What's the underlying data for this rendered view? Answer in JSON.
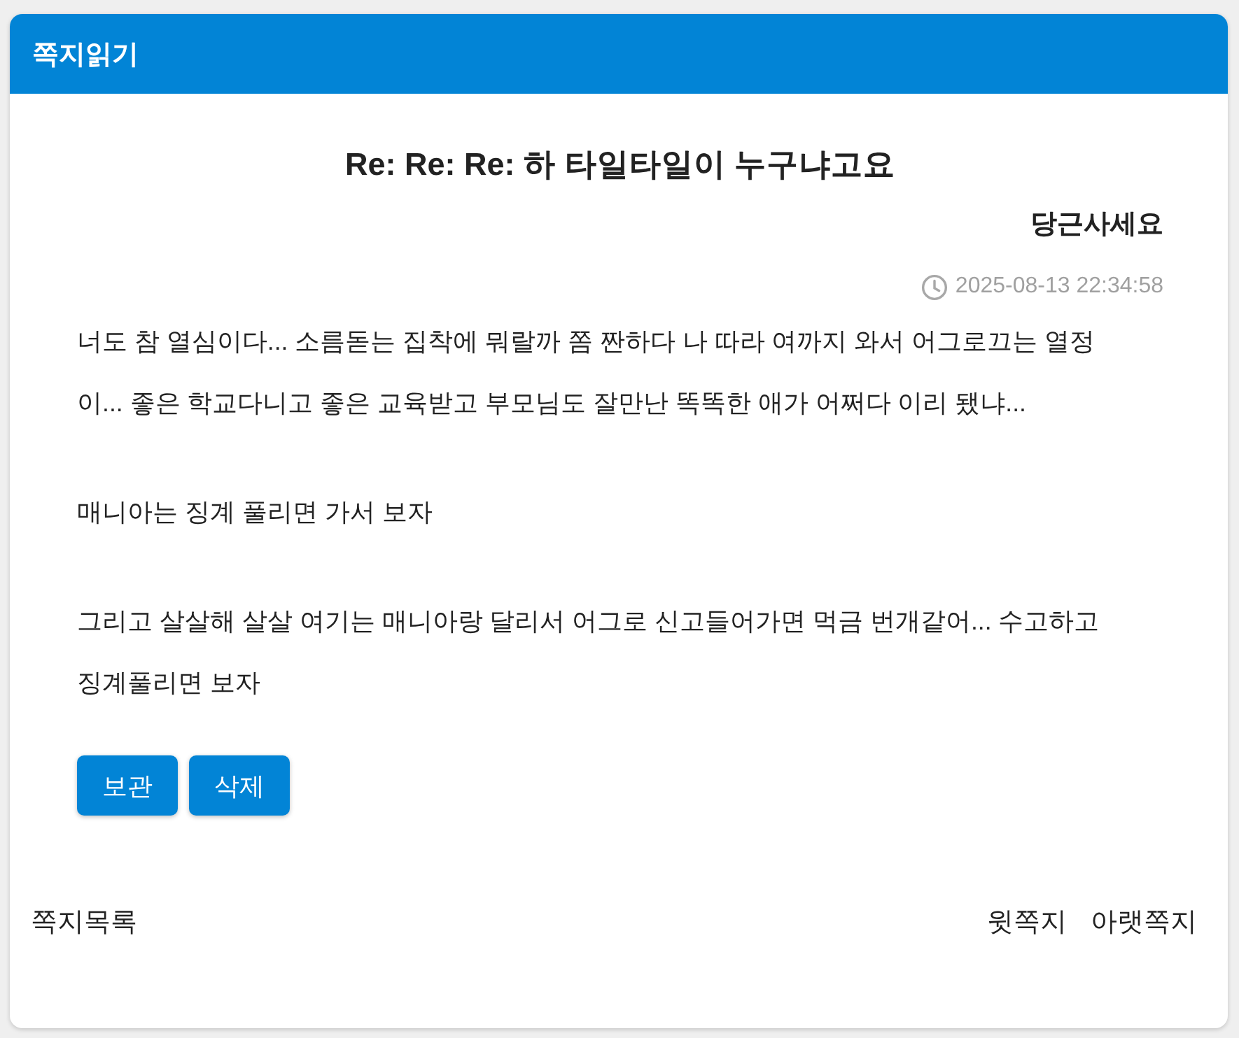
{
  "window": {
    "title": "쪽지읽기"
  },
  "message": {
    "subject": "Re: Re: Re: 하 타일타일이 누구냐고요",
    "sender": "당근사세요",
    "date": "2025-08-13 22:34:58",
    "paragraphs": [
      "너도 참 열심이다... 소름돋는 집착에 뭐랄까 쫌 짠하다 나 따라 여까지 와서 어그로끄는 열정이... 좋은 학교다니고 좋은 교육받고 부모님도 잘만난 똑똑한 애가 어쩌다 이리 됐냐...",
      "매니아는 징계 풀리면 가서 보자",
      "그리고 살살해 살살 여기는 매니아랑 달리서 어그로 신고들어가면 먹금 번개같어... 수고하고 징계풀리면 보자"
    ]
  },
  "actions": [
    "보관",
    "삭제"
  ],
  "footer": {
    "list_link": "쪽지목록",
    "nav_links": [
      "윗쪽지",
      "아랫쪽지"
    ]
  }
}
